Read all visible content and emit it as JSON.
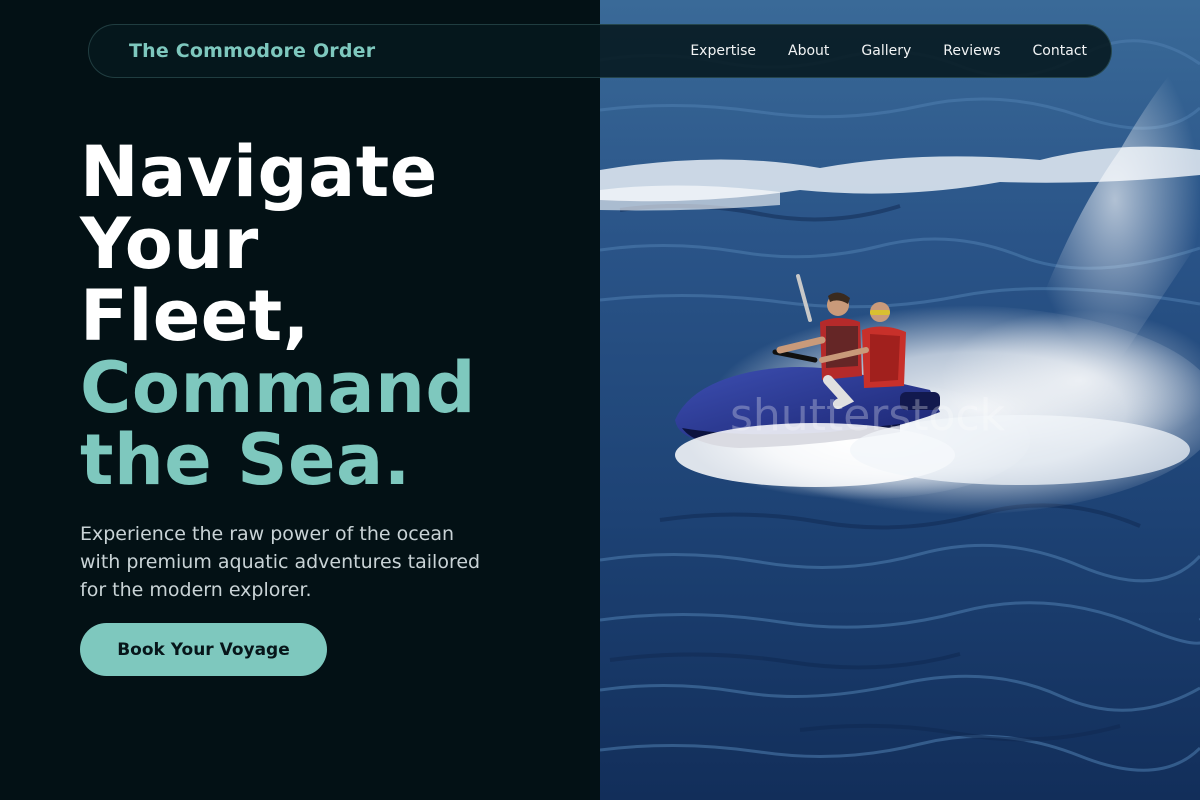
{
  "header": {
    "brand": "The Commodore Order",
    "nav": [
      {
        "label": "Expertise"
      },
      {
        "label": "About"
      },
      {
        "label": "Gallery"
      },
      {
        "label": "Reviews"
      },
      {
        "label": "Contact"
      }
    ]
  },
  "hero": {
    "headline_lines": [
      "Navigate",
      "Your",
      "Fleet,"
    ],
    "headline_accent_lines": [
      "Command",
      "the Sea."
    ],
    "subtext_lines": [
      "Experience the raw power of the ocean",
      "with premium aquatic adventures tailored",
      "for the modern explorer."
    ],
    "cta_label": "Book Your Voyage",
    "image_description": "Two riders in red life vests on a blue jet ski spraying white water across a deep blue sea",
    "watermark_text": "shutterstock"
  },
  "colors": {
    "background": "#031115",
    "accent": "#7ec8be",
    "text": "#ffffff",
    "muted_text": "#c9d3d6"
  }
}
